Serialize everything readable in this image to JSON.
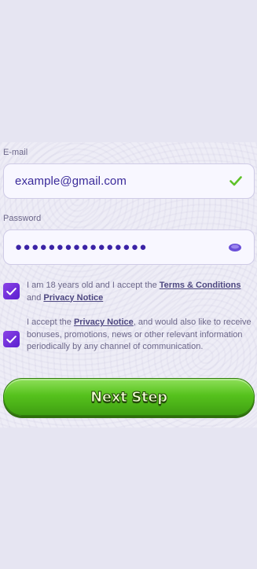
{
  "form": {
    "email_label": "E-mail",
    "email_value": "example@gmail.com",
    "password_label": "Password",
    "password_mask": "●●●●●●●●●●●●●●●●",
    "icons": {
      "email_valid": "checkmark-icon",
      "password_toggle": "eye-icon",
      "checkbox_check": "checkmark-icon"
    },
    "colors": {
      "accent": "#5a1fcf",
      "valid": "#5ec229",
      "button": "#56c21d"
    }
  },
  "consents": {
    "age": {
      "text_before": "I am 18 years old and I accept the ",
      "terms_link": "Terms & Conditions",
      "text_middle": " and ",
      "privacy_link": "Privacy Notice",
      "checked": true
    },
    "marketing": {
      "text_before": "I accept the ",
      "privacy_link": "Privacy Notice",
      "text_after": ", and would also like to receive bonuses, promotions, news or other relevant information periodically by any channel of communication.",
      "checked": true
    }
  },
  "next_button": {
    "label": "Next Step"
  }
}
